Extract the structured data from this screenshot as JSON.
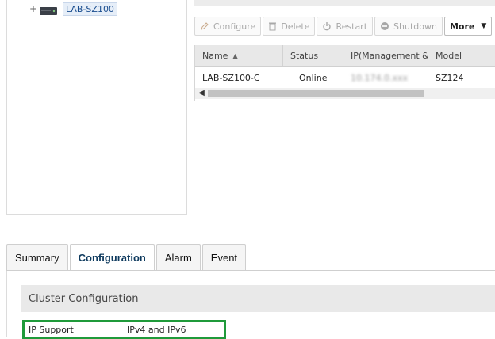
{
  "tree": {
    "expander": "+",
    "node_label": "LAB-SZ100"
  },
  "toolbar": {
    "configure": "Configure",
    "delete": "Delete",
    "restart": "Restart",
    "shutdown": "Shutdown",
    "more": "More"
  },
  "grid": {
    "columns": [
      "Name",
      "Status",
      "IP(Management & AP",
      "Model"
    ],
    "sort_column": "Name",
    "sort_direction": "ascending",
    "rows": [
      {
        "name": "LAB-SZ100-C",
        "status": "Online",
        "ip": "10.174.0.xxx",
        "model": "SZ124"
      }
    ]
  },
  "tabs": [
    {
      "label": "Summary",
      "active": false
    },
    {
      "label": "Configuration",
      "active": true
    },
    {
      "label": "Alarm",
      "active": false
    },
    {
      "label": "Event",
      "active": false
    }
  ],
  "section": {
    "title": "Cluster Configuration",
    "properties": [
      {
        "key": "IP Support",
        "value": "IPv4 and IPv6"
      }
    ]
  },
  "colors": {
    "highlight_border": "#1f9a3a",
    "active_tab_text": "#0e3a5e",
    "tree_label_text": "#1a4d8f"
  }
}
